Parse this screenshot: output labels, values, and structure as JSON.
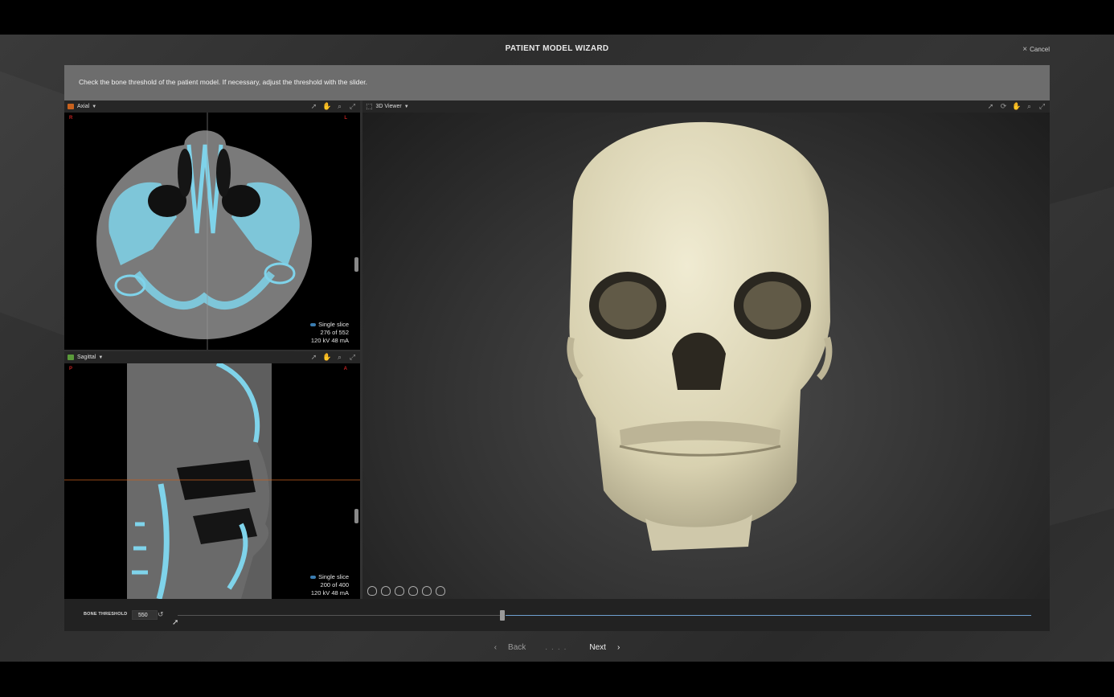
{
  "wizard": {
    "title": "PATIENT MODEL WIZARD",
    "cancel_label": "Cancel"
  },
  "instruction": "Check the bone threshold of the patient model. If necessary, adjust the threshold with the slider.",
  "axial": {
    "title": "Axial",
    "orient_left": "R",
    "orient_right": "L",
    "mode": "Single slice",
    "slice": "276 of 552",
    "params": "120 kV  48 mA",
    "header_icon_color": "#c8621e"
  },
  "sagittal": {
    "title": "Sagittal",
    "orient_left": "P",
    "orient_right": "A",
    "mode": "Single slice",
    "slice": "200 of 400",
    "params": "120 kV  48 mA",
    "header_icon_color": "#5a9a3a"
  },
  "viewer3d": {
    "title": "3D Viewer"
  },
  "threshold": {
    "label": "BONE THRESHOLD",
    "value": "550",
    "position": 0.38,
    "active_color": "#6fa0d0"
  },
  "nav": {
    "back_label": "Back",
    "dots": "....",
    "next_label": "Next"
  },
  "colors": {
    "bone_ct": "#7fd3ea",
    "skull": "#e6e0c4",
    "orientation": "#c02020"
  }
}
